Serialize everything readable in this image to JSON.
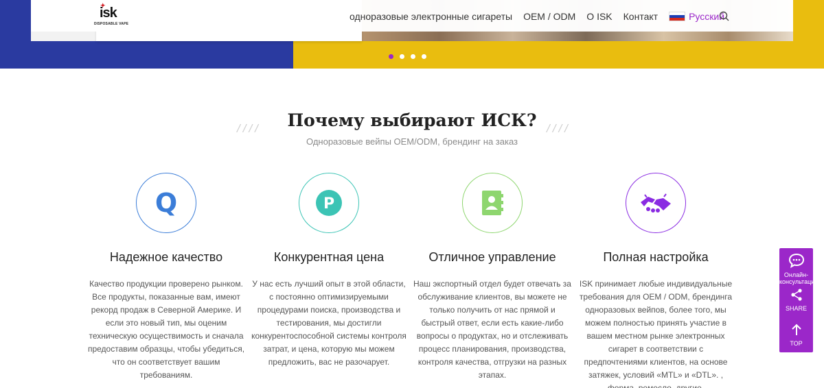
{
  "header": {
    "logo_text": "isk",
    "logo_subtitle": "DISPOSABLE VAPE",
    "nav": [
      {
        "label": "одноразовые электронные сигареты"
      },
      {
        "label": "OEM / ODM"
      },
      {
        "label": "O ISK"
      },
      {
        "label": "Контакт"
      }
    ],
    "language": "Русский",
    "search_icon": "search-icon"
  },
  "hero": {
    "slide_count": 4,
    "active_slide": 1
  },
  "section": {
    "title": "Почему выбирают ИСК?",
    "decor_left": "////",
    "decor_right": "////",
    "subtitle": "Одноразовые вейпы OEM/ODM, брендинг на заказ"
  },
  "features": [
    {
      "icon": "q-letter-icon",
      "accent": "#3b7dd8",
      "title": "Надежное качество",
      "text": "Качество продукции проверено рынком. Все продукты, показанные вам, имеют рекорд продаж в Северной Америке. И если это новый тип, мы оценим техническую осуществимость и сначала предоставим образцы, чтобы убедиться, что он соответствует вашим требованиям."
    },
    {
      "icon": "p-letter-icon",
      "accent": "#3cc4b5",
      "title": "Конкурентная цена",
      "text": "У нас есть лучший опыт в этой области, с постоянно оптимизируемыми процедурами поиска, производства и тестирования, мы достигли конкурентоспособной системы контроля затрат, и цена, которую мы можем предложить, вас не разочарует."
    },
    {
      "icon": "contact-book-icon",
      "accent": "#8ed66f",
      "title": "Отличное управление",
      "text": "Наш экспортный отдел будет отвечать за обслуживание клиентов, вы можете не только получить от нас прямой и быстрый ответ, если есть какие-либо вопросы о продуктах, но и отслеживать процесс планирования, производства, контроля качества, отгрузки на разных этапах."
    },
    {
      "icon": "handshake-icon",
      "accent": "#8a2be2",
      "title": "Полная настройка",
      "text": "ISK принимает любые индивидуальные требования для OEM / ODM, брендинга одноразовых вейпов, более того, мы можем полностью принять участие в вашем местном рынке электронных сигарет в соответствии с предпочтениями клиентов, на основе затяжек, условий «MTL» и «DTL». , форма, ремесло, другие."
    }
  ],
  "side_bar": {
    "accent": "#9b27c9",
    "items": [
      {
        "icon": "chat-icon",
        "label": "Онлайн-консультация"
      },
      {
        "icon": "share-icon",
        "label": "SHARE"
      },
      {
        "icon": "arrow-up-icon",
        "label": "TOP"
      }
    ]
  }
}
